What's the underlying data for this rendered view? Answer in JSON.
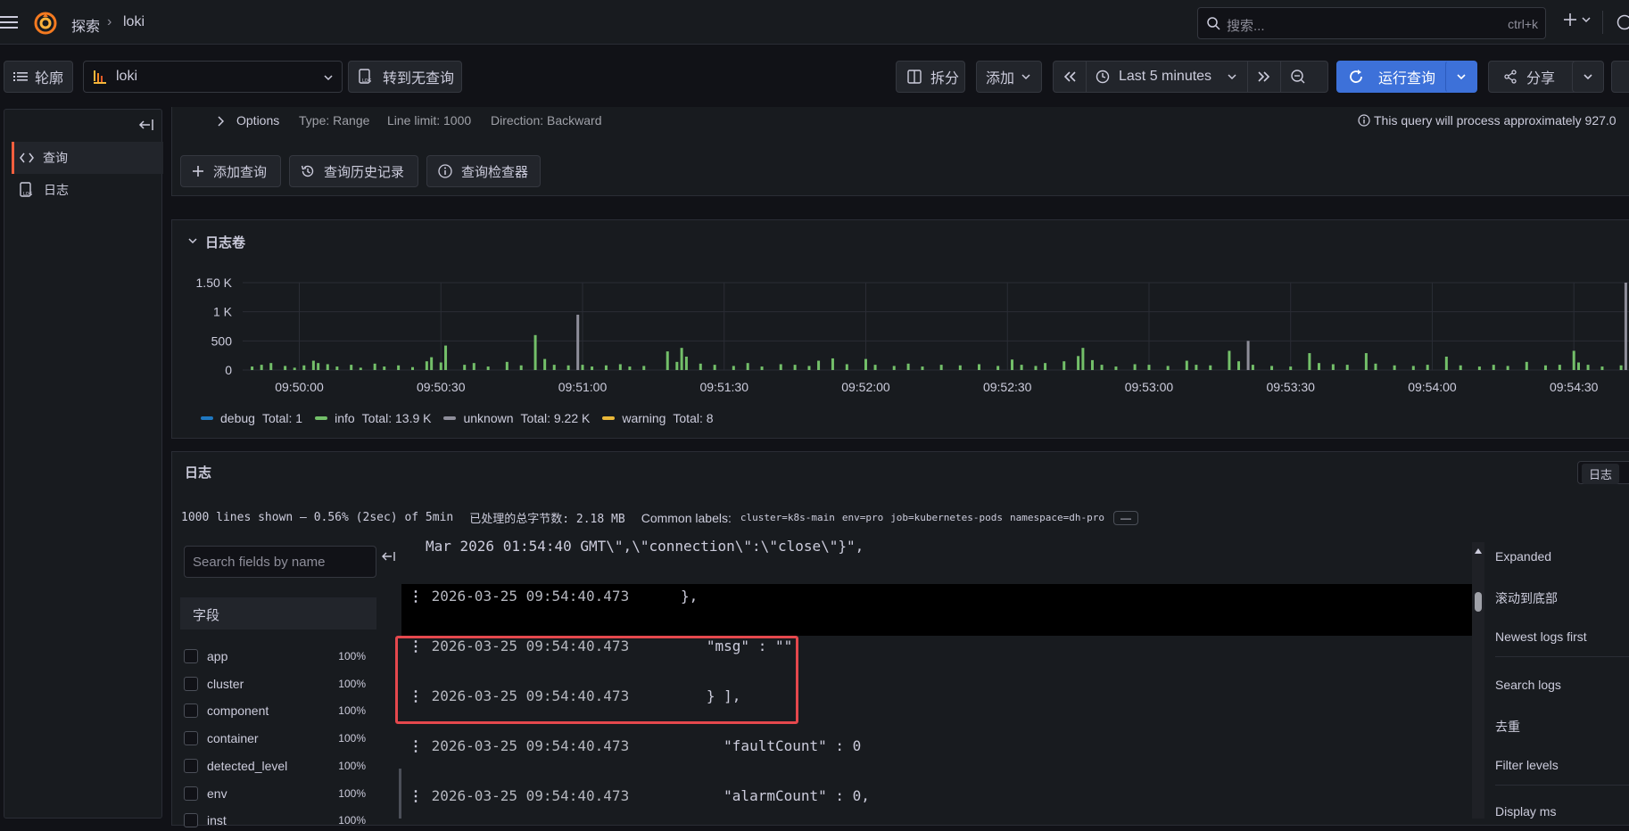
{
  "topbar": {
    "breadcrumb": [
      "探索",
      "loki"
    ],
    "search_placeholder": "搜索...",
    "search_shortcut": "ctrl+k"
  },
  "toolbar": {
    "outline_label": "轮廓",
    "datasource": "loki",
    "no_query_label": "转到无查询",
    "split_label": "拆分",
    "add_label": "添加",
    "time_range": "Last 5 minutes",
    "run_query_label": "运行查询",
    "share_label": "分享"
  },
  "sidebar": {
    "items": [
      {
        "label": "查询",
        "active": true
      },
      {
        "label": "日志",
        "active": false
      }
    ]
  },
  "options_bar": {
    "title": "Options",
    "type": "Type: Range",
    "line_limit": "Line limit: 1000",
    "direction": "Direction: Backward",
    "estimate": "This query will process approximately 927.0"
  },
  "query_actions": {
    "add_query": "添加查询",
    "history": "查询历史记录",
    "inspector": "查询检查器"
  },
  "log_volume": {
    "title": "日志卷"
  },
  "chart_data": {
    "type": "bar",
    "ylim": [
      0,
      1500
    ],
    "y_ticks": [
      "0",
      "500",
      "1 K",
      "1.50 K"
    ],
    "y_tick_values": [
      0,
      500,
      1000,
      1500
    ],
    "x_ticks": [
      "09:50:00",
      "09:50:30",
      "09:51:00",
      "09:51:30",
      "09:52:00",
      "09:52:30",
      "09:53:00",
      "09:53:30",
      "09:54:00",
      "09:54:30"
    ],
    "x_tick_seconds": [
      0,
      30,
      60,
      90,
      120,
      150,
      180,
      210,
      240,
      270
    ],
    "x_range_seconds": [
      -12,
      283
    ],
    "series": [
      {
        "name": "info",
        "color": "#73bf69",
        "total": "Total: 13.9 K",
        "points": [
          [
            -10,
            60
          ],
          [
            -8,
            90
          ],
          [
            -6,
            120
          ],
          [
            -3,
            70
          ],
          [
            -1,
            40
          ],
          [
            1,
            80
          ],
          [
            3,
            160
          ],
          [
            4,
            120
          ],
          [
            6,
            100
          ],
          [
            8,
            60
          ],
          [
            11,
            90
          ],
          [
            13,
            40
          ],
          [
            16,
            110
          ],
          [
            18,
            60
          ],
          [
            21,
            80
          ],
          [
            24,
            50
          ],
          [
            27,
            150
          ],
          [
            28,
            220
          ],
          [
            30,
            130
          ],
          [
            31,
            420
          ],
          [
            35,
            90
          ],
          [
            37,
            120
          ],
          [
            40,
            60
          ],
          [
            44,
            140
          ],
          [
            47,
            80
          ],
          [
            50,
            600
          ],
          [
            52,
            190
          ],
          [
            54,
            90
          ],
          [
            57,
            80
          ],
          [
            60,
            90
          ],
          [
            62,
            60
          ],
          [
            65,
            80
          ],
          [
            68,
            100
          ],
          [
            70,
            60
          ],
          [
            73,
            70
          ],
          [
            78,
            320
          ],
          [
            80,
            140
          ],
          [
            81,
            380
          ],
          [
            82,
            230
          ],
          [
            85,
            110
          ],
          [
            88,
            90
          ],
          [
            92,
            70
          ],
          [
            95,
            120
          ],
          [
            98,
            60
          ],
          [
            102,
            100
          ],
          [
            105,
            90
          ],
          [
            108,
            70
          ],
          [
            110,
            160
          ],
          [
            113,
            200
          ],
          [
            116,
            100
          ],
          [
            120,
            190
          ],
          [
            122,
            90
          ],
          [
            126,
            70
          ],
          [
            129,
            110
          ],
          [
            132,
            60
          ],
          [
            136,
            90
          ],
          [
            140,
            80
          ],
          [
            144,
            100
          ],
          [
            148,
            70
          ],
          [
            151,
            180
          ],
          [
            153,
            90
          ],
          [
            156,
            70
          ],
          [
            158,
            120
          ],
          [
            162,
            150
          ],
          [
            165,
            240
          ],
          [
            166,
            380
          ],
          [
            168,
            170
          ],
          [
            170,
            90
          ],
          [
            173,
            60
          ],
          [
            177,
            100
          ],
          [
            180,
            90
          ],
          [
            184,
            70
          ],
          [
            188,
            160
          ],
          [
            190,
            90
          ],
          [
            193,
            80
          ],
          [
            197,
            330
          ],
          [
            199,
            150
          ],
          [
            202,
            90
          ],
          [
            206,
            70
          ],
          [
            210,
            60
          ],
          [
            214,
            290
          ],
          [
            216,
            120
          ],
          [
            219,
            100
          ],
          [
            222,
            90
          ],
          [
            226,
            290
          ],
          [
            228,
            110
          ],
          [
            232,
            80
          ],
          [
            236,
            70
          ],
          [
            239,
            90
          ],
          [
            243,
            230
          ],
          [
            246,
            80
          ],
          [
            250,
            60
          ],
          [
            253,
            90
          ],
          [
            256,
            70
          ],
          [
            260,
            140
          ],
          [
            264,
            80
          ],
          [
            267,
            90
          ],
          [
            270,
            330
          ],
          [
            271,
            130
          ],
          [
            273,
            90
          ],
          [
            276,
            60
          ],
          [
            280,
            80
          ],
          [
            282,
            120
          ]
        ]
      },
      {
        "name": "unknown",
        "color": "#8e8e9a",
        "total": "Total: 9.22 K",
        "points": [
          [
            59,
            950
          ],
          [
            201,
            500
          ],
          [
            281,
            1500
          ]
        ]
      },
      {
        "name": "debug",
        "color": "#1f78c1",
        "total": "Total: 1",
        "points": []
      },
      {
        "name": "warning",
        "color": "#eab839",
        "total": "Total: 8",
        "points": []
      }
    ],
    "legend_order": [
      "debug",
      "info",
      "unknown",
      "warning"
    ]
  },
  "logs_panel": {
    "title": "日志",
    "view_toggle": "日志",
    "summary": "1000 lines shown — 0.56% (2sec) of 5min",
    "bytes_processed": "已处理的总字节数: 2.18 MB",
    "common_labels_title": "Common labels:",
    "common_labels": [
      "cluster=k8s-main",
      "env=pro",
      "job=kubernetes-pods",
      "namespace=dh-pro"
    ],
    "collapse_label": "—",
    "field_search_placeholder": "Search fields by name",
    "fields_title": "字段",
    "fields": [
      {
        "name": "app",
        "pct": "100%"
      },
      {
        "name": "cluster",
        "pct": "100%"
      },
      {
        "name": "component",
        "pct": "100%"
      },
      {
        "name": "container",
        "pct": "100%"
      },
      {
        "name": "detected_level",
        "pct": "100%"
      },
      {
        "name": "env",
        "pct": "100%"
      },
      {
        "name": "inst",
        "pct": "100%"
      }
    ],
    "lines": [
      {
        "ts": "",
        "body": "Mar 2026 01:54:40 GMT\\\",\\\"connection\\\":\\\"close\\\"}\","
      },
      {
        "ts": "2026-03-25 09:54:40.473",
        "body": "   },"
      },
      {
        "ts": "2026-03-25 09:54:40.473",
        "body": "      \"msg\" : \"\""
      },
      {
        "ts": "2026-03-25 09:54:40.473",
        "body": "      } ],"
      },
      {
        "ts": "2026-03-25 09:54:40.473",
        "body": "        \"faultCount\" : 0"
      },
      {
        "ts": "2026-03-25 09:54:40.473",
        "body": "        \"alarmCount\" : 0,"
      }
    ],
    "options": [
      "Expanded",
      "滚动到底部",
      "Newest logs first",
      "Search logs",
      "去重",
      "Filter levels",
      "Display ms"
    ]
  }
}
